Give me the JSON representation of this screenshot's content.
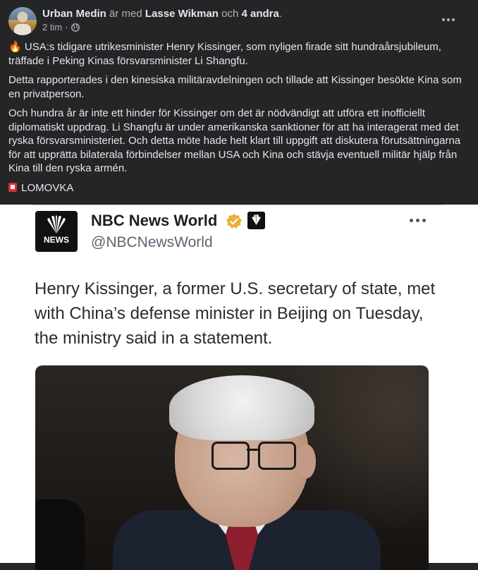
{
  "post": {
    "author": "Urban Medin",
    "with_text": "är med",
    "tagged": "Lasse Wikman",
    "and_text": "och",
    "others": "4 andra",
    "period": ".",
    "time": "2 tim",
    "dot": "·",
    "privacy_icon": "globe-icon",
    "paragraphs": {
      "p1": "USA:s tidigare utrikesminister Henry Kissinger, som nyligen firade sitt hundraårsjubileum, träffade i Peking Kinas försvarsminister Li Shangfu.",
      "p2": "Detta rapporterades i den kinesiska militäravdelningen och tillade att Kissinger besökte Kina som en privatperson.",
      "p3": "Och hundra år är inte ett hinder för Kissinger om det är nödvändigt att utföra ett inofficiellt diplomatiskt uppdrag. Li Shangfu är under amerikanska sanktioner för att ha interagerat med det ryska försvarsministeriet. Och detta möte hade helt klart till uppgift att diskutera förutsättningarna för att upprätta bilaterala förbindelser mellan USA och Kina och stävja eventuell militär hjälp från Kina till den ryska armén.",
      "p4": "LOMOVKA"
    },
    "fire_emoji": "🔥"
  },
  "tweet": {
    "logo_text": "NEWS",
    "name": "NBC News World",
    "handle": "@NBCNewsWorld",
    "text": "Henry Kissinger, a former U.S. secretary of state, met with China’s defense minister in Beijing on Tuesday, the ministry said in a statement."
  },
  "colors": {
    "background": "#242526",
    "text": "#e4e6eb",
    "muted": "#b0b3b8",
    "verified": "#e8b13a"
  }
}
